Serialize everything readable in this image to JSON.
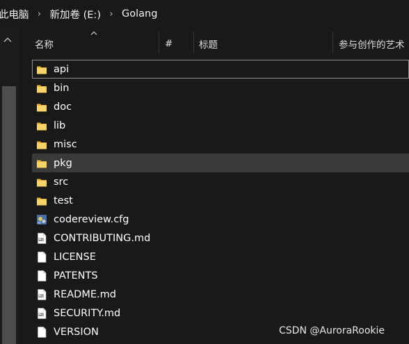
{
  "breadcrumb": {
    "items": [
      "此电脑",
      "新加卷 (E:)",
      "Golang"
    ],
    "separator": "›"
  },
  "columns": {
    "name": "名称",
    "number": "#",
    "title": "标题",
    "contributors": "参与创作的艺术"
  },
  "files": [
    {
      "name": "api",
      "type": "folder"
    },
    {
      "name": "bin",
      "type": "folder"
    },
    {
      "name": "doc",
      "type": "folder"
    },
    {
      "name": "lib",
      "type": "folder"
    },
    {
      "name": "misc",
      "type": "folder"
    },
    {
      "name": "pkg",
      "type": "folder"
    },
    {
      "name": "src",
      "type": "folder"
    },
    {
      "name": "test",
      "type": "folder"
    },
    {
      "name": "codereview.cfg",
      "type": "cfg"
    },
    {
      "name": "CONTRIBUTING.md",
      "type": "md"
    },
    {
      "name": "LICENSE",
      "type": "file"
    },
    {
      "name": "PATENTS",
      "type": "file"
    },
    {
      "name": "README.md",
      "type": "md"
    },
    {
      "name": "SECURITY.md",
      "type": "md"
    },
    {
      "name": "VERSION",
      "type": "file"
    }
  ],
  "focused_item": "api",
  "hovered_item": "pkg",
  "icons": {
    "folder": "folder-icon",
    "file": "file-icon",
    "md": "markdown-file-icon",
    "cfg": "config-file-icon",
    "sort": "sort-ascending-icon",
    "scroll_up": "scroll-up-arrow-icon"
  },
  "colors": {
    "background": "#191919",
    "hover_row": "#3a3a3a",
    "folder_yellow": "#f2c94c",
    "text": "#ffffff"
  },
  "watermark": "CSDN @AuroraRookie"
}
